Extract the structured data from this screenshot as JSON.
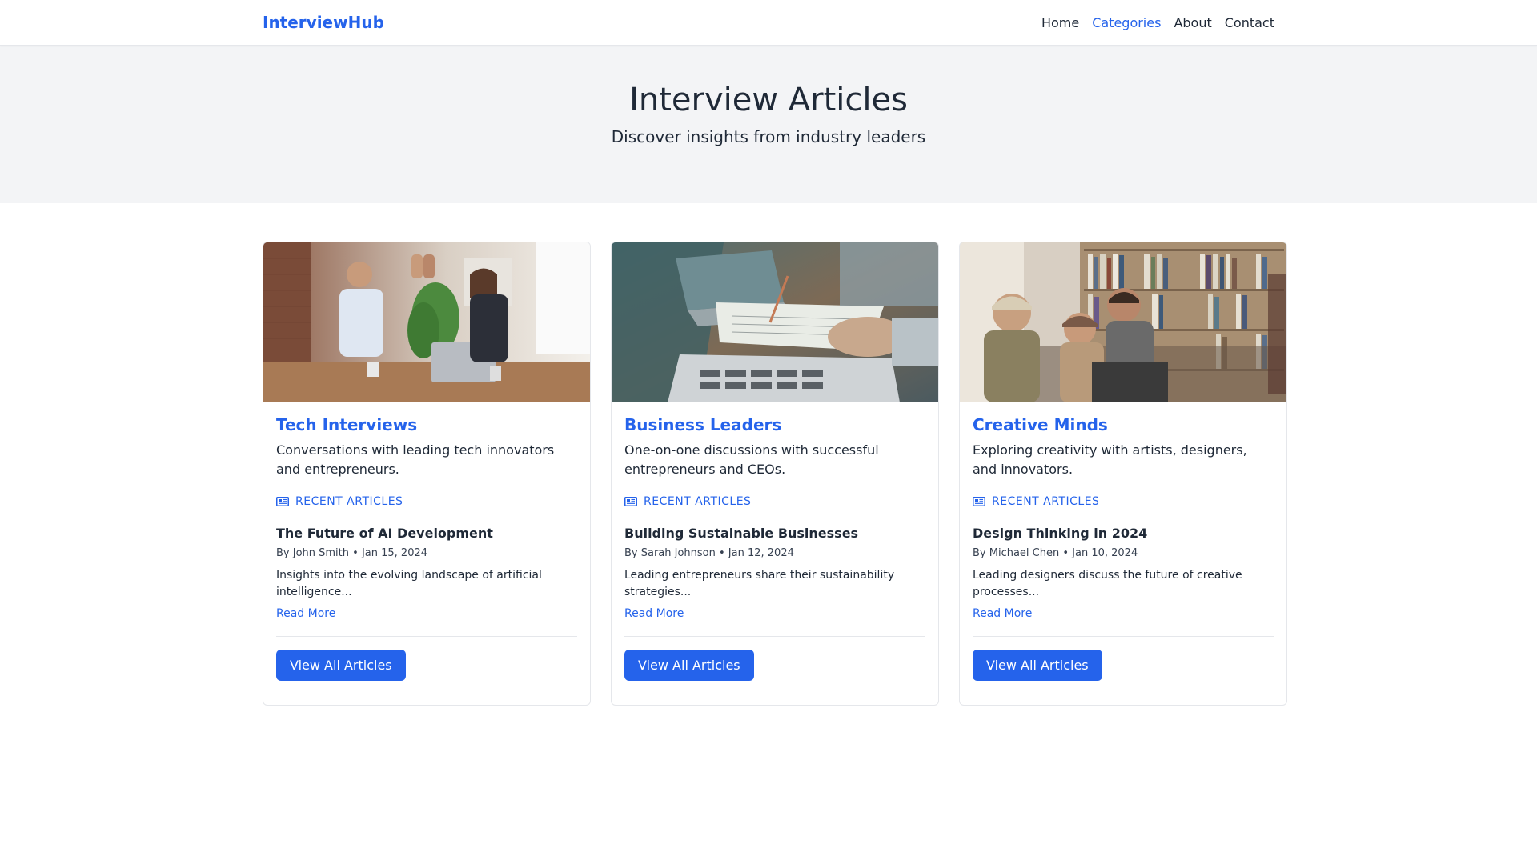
{
  "navbar": {
    "brand": "InterviewHub",
    "links": [
      "Home",
      "Categories",
      "About",
      "Contact"
    ]
  },
  "hero": {
    "title": "Interview Articles",
    "subtitle": "Discover insights from industry leaders"
  },
  "colors": {
    "accent": "#2563eb",
    "hero_bg": "#f3f4f6",
    "text": "#1f2937"
  },
  "cards": [
    {
      "title": "Tech Interviews",
      "description": "Conversations with leading tech innovators and entrepreneurs.",
      "recent_label": "RECENT ARTICLES",
      "article": {
        "title": "The Future of AI Development",
        "meta": "By John Smith • Jan 15, 2024",
        "excerpt": "Insights into the evolving landscape of artificial intelligence...",
        "read_more": "Read More"
      },
      "button": "View All Articles"
    },
    {
      "title": "Business Leaders",
      "description": "One-on-one discussions with successful entrepreneurs and CEOs.",
      "recent_label": "RECENT ARTICLES",
      "article": {
        "title": "Building Sustainable Businesses",
        "meta": "By Sarah Johnson • Jan 12, 2024",
        "excerpt": "Leading entrepreneurs share their sustainability strategies...",
        "read_more": "Read More"
      },
      "button": "View All Articles"
    },
    {
      "title": "Creative Minds",
      "description": "Exploring creativity with artists, designers, and innovators.",
      "recent_label": "RECENT ARTICLES",
      "article": {
        "title": "Design Thinking in 2024",
        "meta": "By Michael Chen • Jan 10, 2024",
        "excerpt": "Leading designers discuss the future of creative processes...",
        "read_more": "Read More"
      },
      "button": "View All Articles"
    }
  ]
}
